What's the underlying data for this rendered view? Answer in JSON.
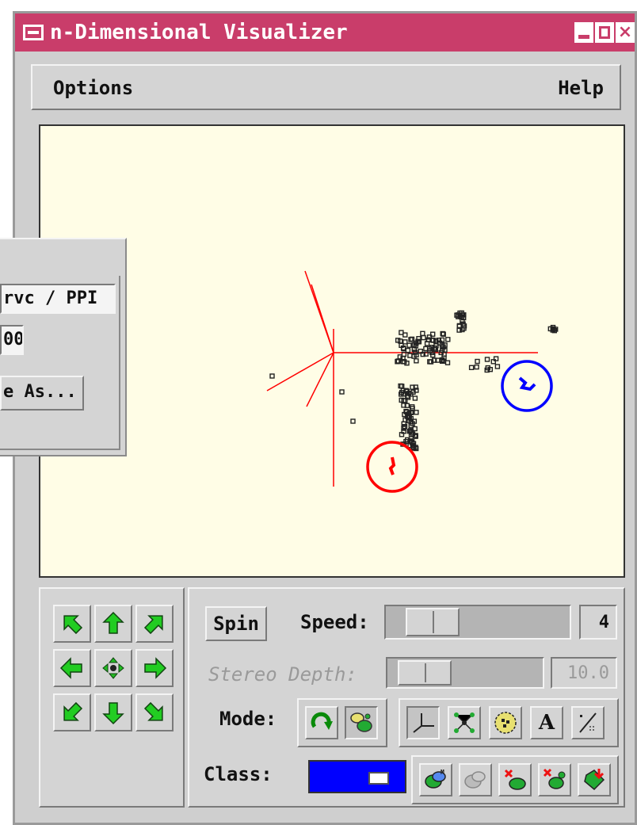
{
  "window": {
    "title": "n-Dimensional Visualizer"
  },
  "menubar": {
    "options": "Options",
    "help": "Help"
  },
  "side_panel": {
    "field1": "rvc / PPI",
    "field2": "00",
    "button": "e As..."
  },
  "plot": {
    "background": "#fffde6",
    "axis_color": "#ff0000",
    "point_color": "#222222",
    "red_class_color": "#ff0000",
    "blue_class_color": "#0000ff"
  },
  "navigation": {
    "buttons": [
      {
        "name": "rotate-up-left-button",
        "icon": "arrow-up-left-icon"
      },
      {
        "name": "rotate-up-button",
        "icon": "arrow-up-icon"
      },
      {
        "name": "rotate-up-right-button",
        "icon": "arrow-up-right-icon"
      },
      {
        "name": "rotate-left-button",
        "icon": "arrow-left-icon"
      },
      {
        "name": "center-button",
        "icon": "move-icon"
      },
      {
        "name": "rotate-right-button",
        "icon": "arrow-right-icon"
      },
      {
        "name": "rotate-down-left-button",
        "icon": "arrow-down-left-icon"
      },
      {
        "name": "rotate-down-button",
        "icon": "arrow-down-icon"
      },
      {
        "name": "rotate-down-right-button",
        "icon": "arrow-down-right-icon"
      }
    ]
  },
  "controls": {
    "spin_label": "Spin",
    "speed_label": "Speed:",
    "speed_value": "4",
    "speed_level": 0.15,
    "stereo_label": "Stereo Depth:",
    "stereo_value": "10.0",
    "stereo_level": 0.1,
    "mode_label": "Mode:",
    "class_label": "Class:",
    "class_color": "#0000ff",
    "mode_icons": [
      "rotate-icon",
      "paint-blobs-icon"
    ],
    "tool_icons": [
      "axes-icon",
      "network-icon",
      "cluster-icon",
      "label-a-icon",
      "slash-grid-icon"
    ],
    "class_icons": [
      "class-manage-icon",
      "class-disabled-icon",
      "class-remove-icon",
      "class-delete-icon",
      "class-export-icon"
    ]
  }
}
